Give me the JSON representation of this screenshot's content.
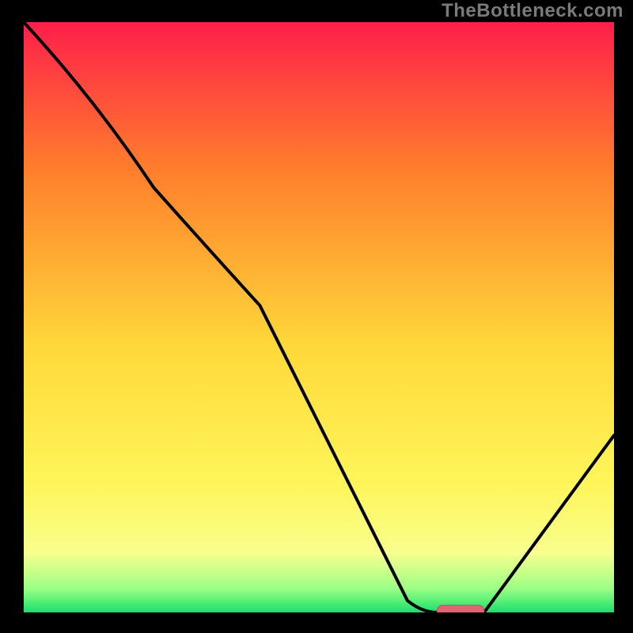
{
  "watermark": "TheBottleneck.com",
  "colors": {
    "bg": "#000000",
    "watermark": "#7a7a7a",
    "curve": "#000000",
    "marker_fill": "#e16474",
    "marker_stroke": "#c34b5c",
    "gradient": {
      "top": "#ff1f4a",
      "mid_upper": "#ff7e2c",
      "mid": "#ffd93a",
      "mid_lower": "#fff55a",
      "lower_band": "#f7ff8e",
      "green_band": "#9bff85",
      "bottom": "#18e06b"
    }
  },
  "chart_data": {
    "type": "line",
    "title": "",
    "xlabel": "",
    "ylabel": "",
    "x": [
      0.0,
      0.22,
      0.4,
      0.65,
      0.7,
      0.78,
      1.0
    ],
    "values": [
      1.0,
      0.72,
      0.52,
      0.02,
      0.0,
      0.0,
      0.3
    ],
    "xlim": [
      0,
      1
    ],
    "ylim": [
      0,
      1
    ],
    "marker": {
      "x_start": 0.7,
      "x_end": 0.78,
      "y": 0.0
    }
  }
}
